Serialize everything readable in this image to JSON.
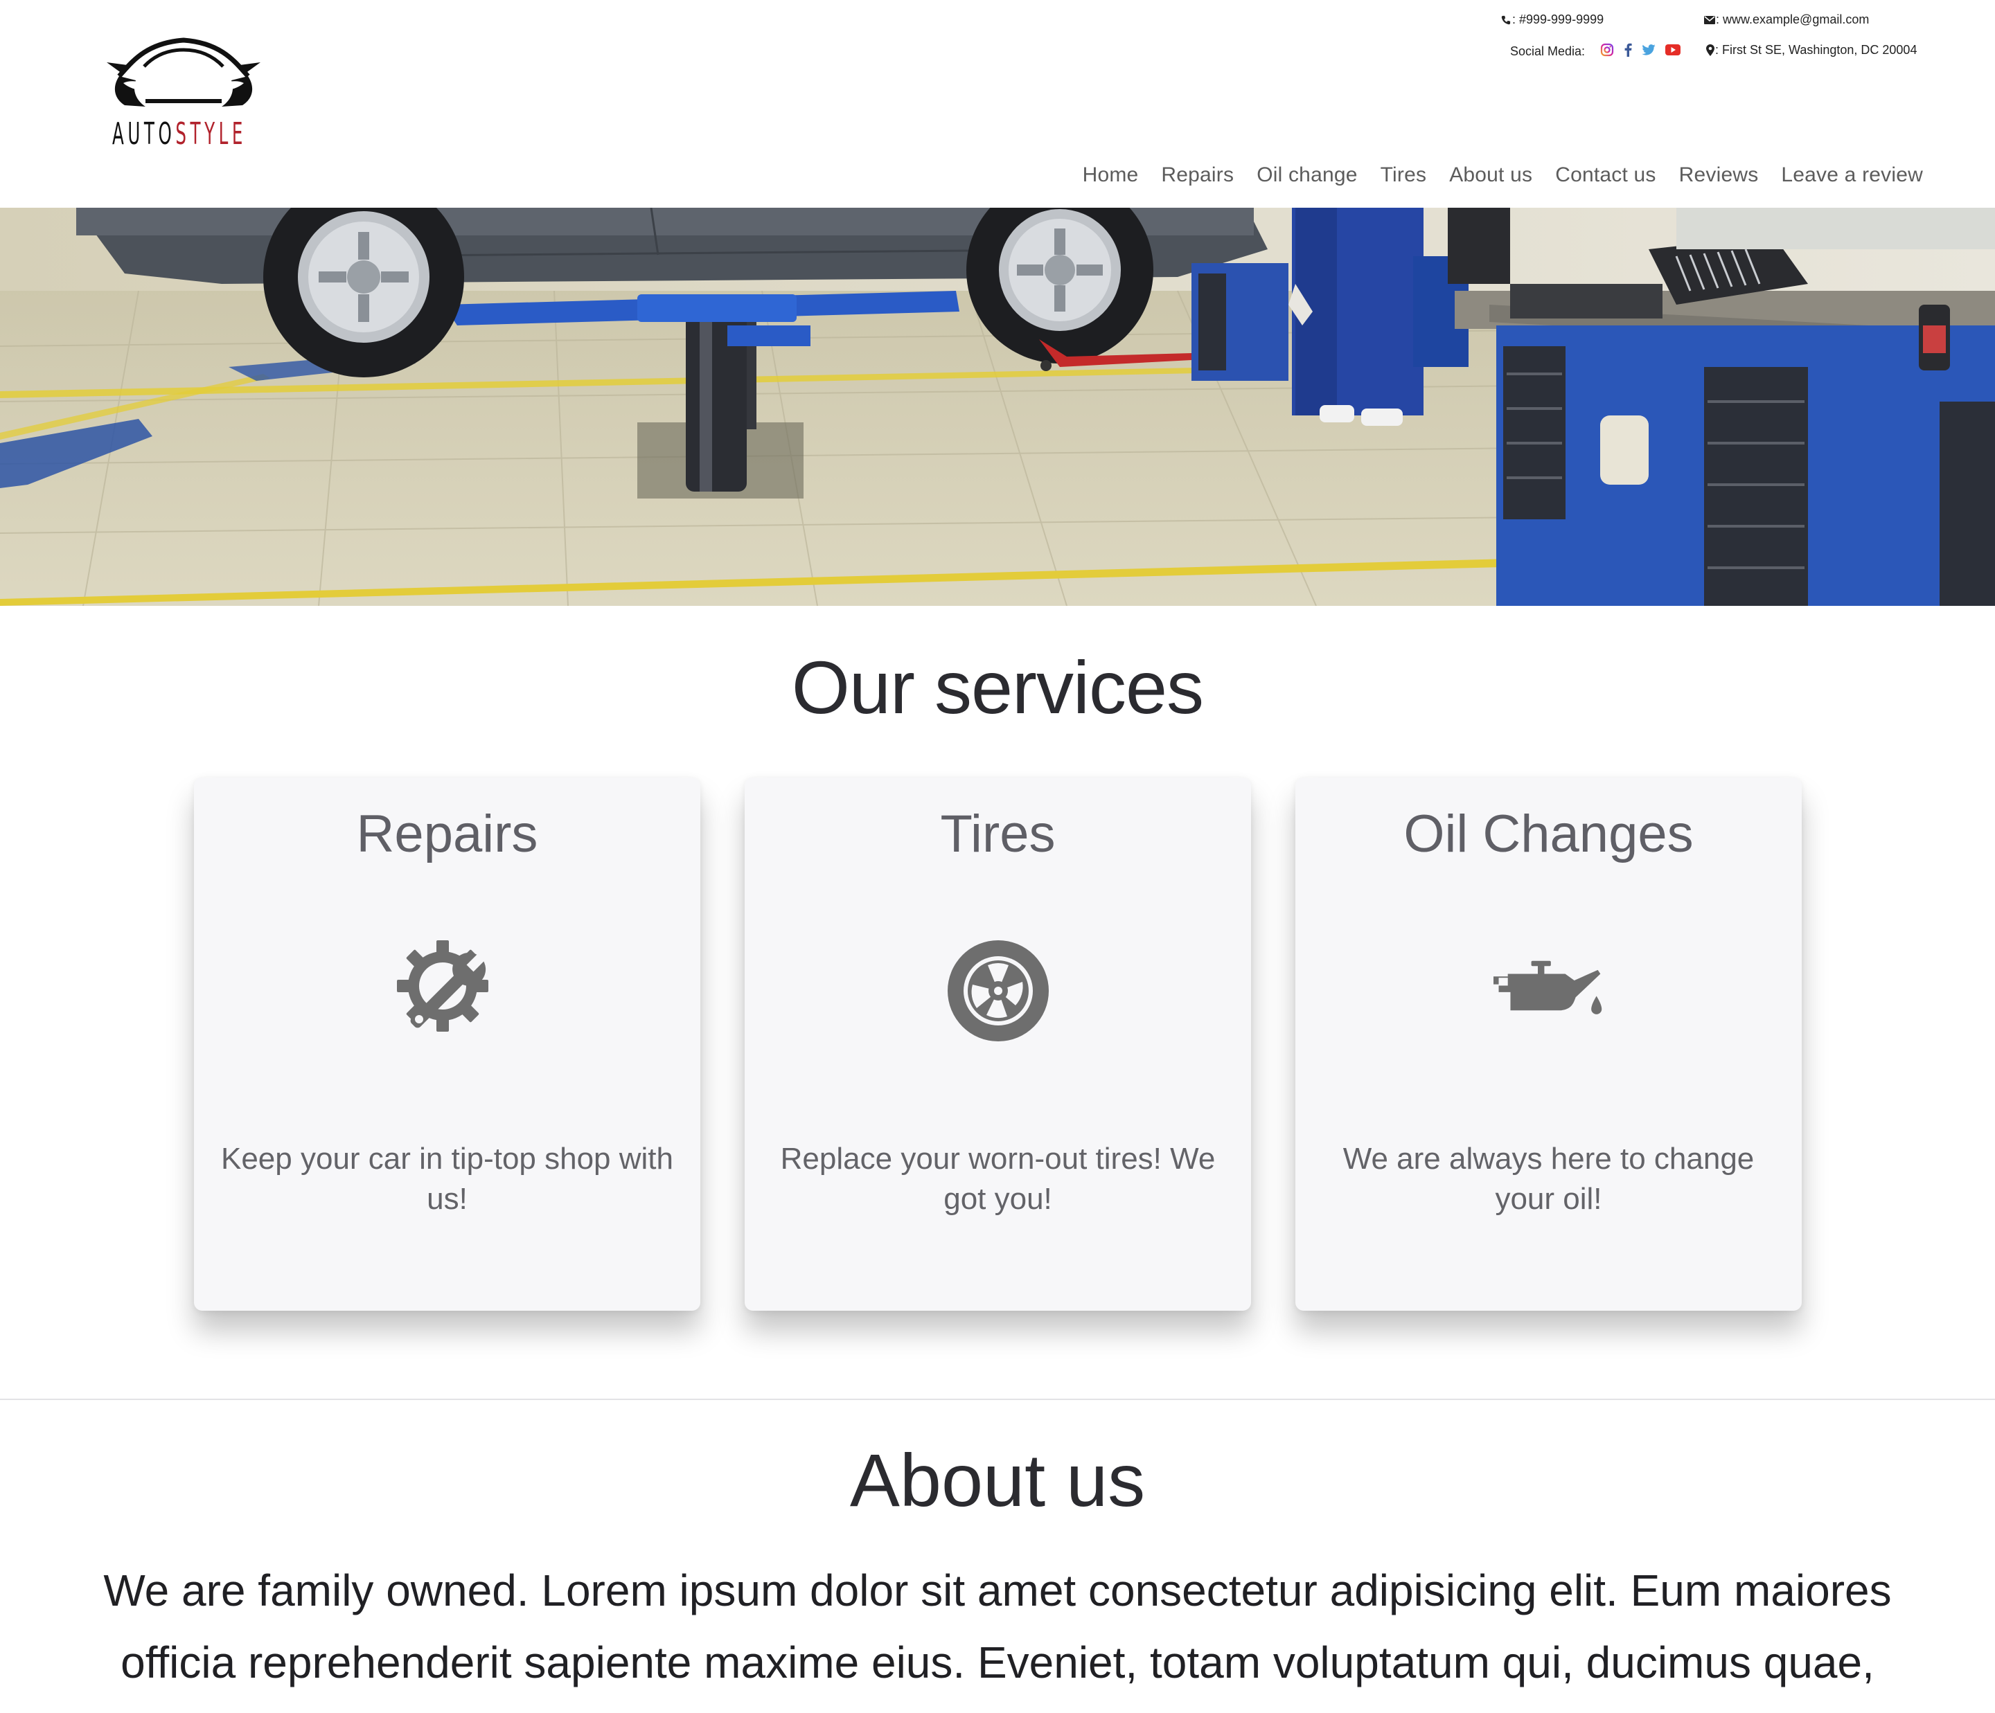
{
  "header": {
    "logo": {
      "text_part1": "AUTO",
      "text_part2": "STYLE",
      "accent_color": "#b1222c"
    },
    "contact": {
      "phone": ": #999-999-9999",
      "email": ": www.example@gmail.com",
      "social_label": "Social Media:",
      "address": ": First St SE, Washington, DC 20004",
      "icons": [
        "phone-icon",
        "envelope-icon",
        "instagram-icon",
        "facebook-icon",
        "twitter-icon",
        "youtube-icon",
        "map-marker-icon"
      ]
    },
    "nav": [
      "Home",
      "Repairs",
      "Oil change",
      "Tires",
      "About us",
      "Contact us",
      "Reviews",
      "Leave a review"
    ]
  },
  "services": {
    "title": "Our services",
    "cards": [
      {
        "title": "Repairs",
        "icon": "gear-wrench-icon",
        "text": "Keep your car in tip-top shop with us!"
      },
      {
        "title": "Tires",
        "icon": "tire-icon",
        "text": "Replace your worn-out tires! We got you!"
      },
      {
        "title": "Oil Changes",
        "icon": "oil-can-icon",
        "text": "We are always here to change your oil!"
      }
    ]
  },
  "about": {
    "title": "About us",
    "text": "We are family owned. Lorem ipsum dolor sit amet consectetur adipisicing elit. Eum maiores officia reprehenderit sapiente maxime eius. Eveniet, totam voluptatum qui, ducimus quae,"
  }
}
